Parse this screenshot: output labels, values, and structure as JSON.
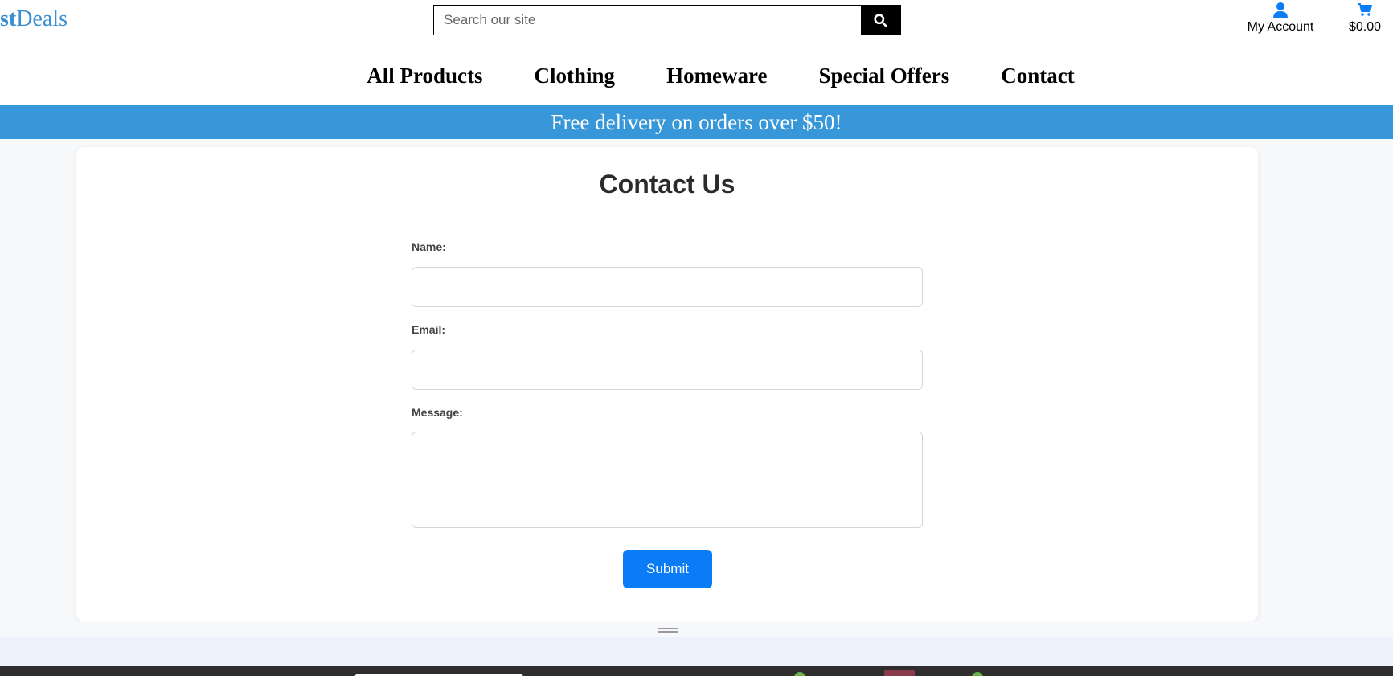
{
  "header": {
    "logo": {
      "part_bold": "st",
      "part_regular": "Deals"
    },
    "search": {
      "placeholder": "Search our site",
      "value": ""
    },
    "account": {
      "label": "My Account"
    },
    "cart": {
      "total": "$0.00"
    }
  },
  "nav": {
    "items": [
      {
        "label": "All Products"
      },
      {
        "label": "Clothing"
      },
      {
        "label": "Homeware"
      },
      {
        "label": "Special Offers"
      },
      {
        "label": "Contact"
      }
    ]
  },
  "promo": {
    "text": "Free delivery on orders over $50!"
  },
  "contact_form": {
    "title": "Contact Us",
    "name_label": "Name:",
    "name_value": "",
    "email_label": "Email:",
    "email_value": "",
    "message_label": "Message:",
    "message_value": "",
    "submit_label": "Submit"
  },
  "colors": {
    "brand_blue": "#3a8fd1",
    "promo_bg": "#3897d8",
    "submit_bg": "#0a7cf5",
    "icon_blue": "#0a7cf5"
  },
  "icons": {
    "search": "magnifier-icon",
    "account": "user-icon",
    "cart": "shopping-cart-icon"
  }
}
